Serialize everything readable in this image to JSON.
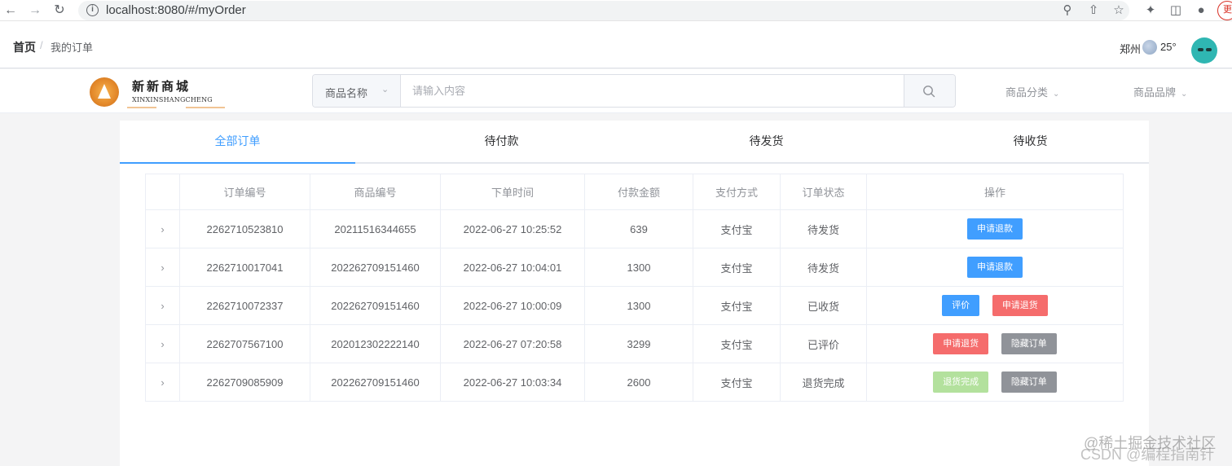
{
  "browser": {
    "url": "localhost:8080/#/myOrder",
    "profile_label": "更"
  },
  "header": {
    "breadcrumb": [
      "首页",
      "我的订单"
    ],
    "breadcrumb_separator": "/",
    "weather_city": "郑州",
    "weather_temp": "25°"
  },
  "logo": {
    "title": "新新商城",
    "subtitle": "XINXINSHANGCHENG"
  },
  "search": {
    "select_label": "商品名称",
    "placeholder": "请输入内容",
    "category_label": "商品分类",
    "brand_label": "商品品牌"
  },
  "tabs": [
    "全部订单",
    "待付款",
    "待发货",
    "待收货"
  ],
  "active_tab": "全部订单",
  "table": {
    "headers": [
      "订单编号",
      "商品编号",
      "下单时间",
      "付款金额",
      "支付方式",
      "订单状态",
      "操作"
    ],
    "rows": [
      {
        "order_no": "2262710523810",
        "goods_no": "20211516344655",
        "time": "2022-06-27 10:25:52",
        "amount": "639",
        "pay": "支付宝",
        "status": "待发货",
        "actions": [
          {
            "label": "申请退款",
            "type": "primary"
          }
        ]
      },
      {
        "order_no": "2262710017041",
        "goods_no": "202262709151460",
        "time": "2022-06-27 10:04:01",
        "amount": "1300",
        "pay": "支付宝",
        "status": "待发货",
        "actions": [
          {
            "label": "申请退款",
            "type": "primary"
          }
        ]
      },
      {
        "order_no": "2262710072337",
        "goods_no": "202262709151460",
        "time": "2022-06-27 10:00:09",
        "amount": "1300",
        "pay": "支付宝",
        "status": "已收货",
        "actions": [
          {
            "label": "评价",
            "type": "primary"
          },
          {
            "label": "申请退货",
            "type": "danger"
          }
        ]
      },
      {
        "order_no": "2262707567100",
        "goods_no": "202012302222140",
        "time": "2022-06-27 07:20:58",
        "amount": "3299",
        "pay": "支付宝",
        "status": "已评价",
        "actions": [
          {
            "label": "申请退货",
            "type": "danger"
          },
          {
            "label": "隐藏订单",
            "type": "info"
          }
        ]
      },
      {
        "order_no": "2262709085909",
        "goods_no": "202262709151460",
        "time": "2022-06-27 10:03:34",
        "amount": "2600",
        "pay": "支付宝",
        "status": "退货完成",
        "actions": [
          {
            "label": "退货完成",
            "type": "success-disabled"
          },
          {
            "label": "隐藏订单",
            "type": "info"
          }
        ]
      }
    ]
  },
  "watermark": [
    "@稀土掘金技术社区",
    "CSDN @编程指南针"
  ],
  "colors": {
    "primary": "#409eff",
    "danger": "#f56c6c",
    "info": "#909399",
    "success_disabled": "#b3e19d"
  }
}
